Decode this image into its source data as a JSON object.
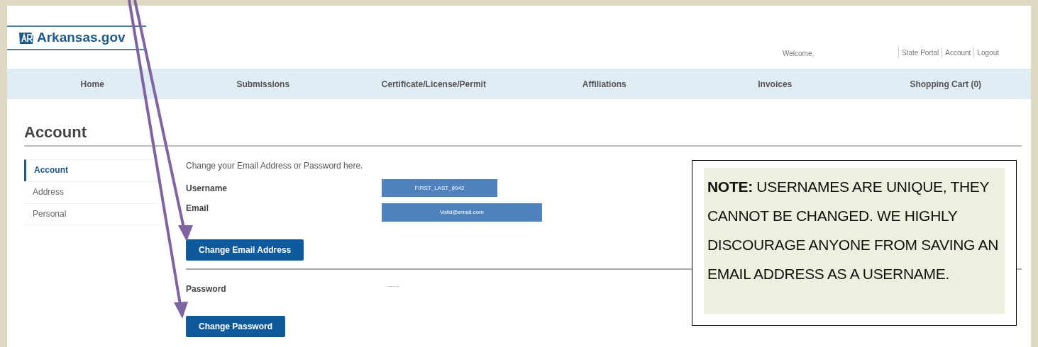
{
  "header": {
    "logo_text": "Arkansas.gov",
    "welcome": "Welcome,",
    "links": [
      "State Portal",
      "Account",
      "Logout"
    ]
  },
  "nav": [
    "Home",
    "Submissions",
    "Certificate/License/Permit",
    "Affiliations",
    "Invoices",
    "Shopping Cart (0)"
  ],
  "page_title": "Account",
  "sidebar": {
    "items": [
      {
        "label": "Account",
        "selected": true
      },
      {
        "label": "Address",
        "selected": false
      },
      {
        "label": "Personal",
        "selected": false
      }
    ]
  },
  "intro": "Change your Email Address or Password here.",
  "fields": [
    {
      "label": "Username",
      "value": "FIRST_LAST_8942",
      "kind": "box"
    },
    {
      "label": "Email",
      "value": "Valid@email.com",
      "kind": "wide-box",
      "button": "Change Email Address"
    },
    {
      "label": "Password",
      "value": "........",
      "kind": "plain",
      "button": "Change Password"
    }
  ],
  "note": "**NOTE:** USERNAMES ARE UNIQUE, THEY CANNOT BE CHANGED. WE HIGHLY DISCOURAGE ANYONE FROM SAVING AN EMAIL ADDRESS AS A USERNAME."
}
